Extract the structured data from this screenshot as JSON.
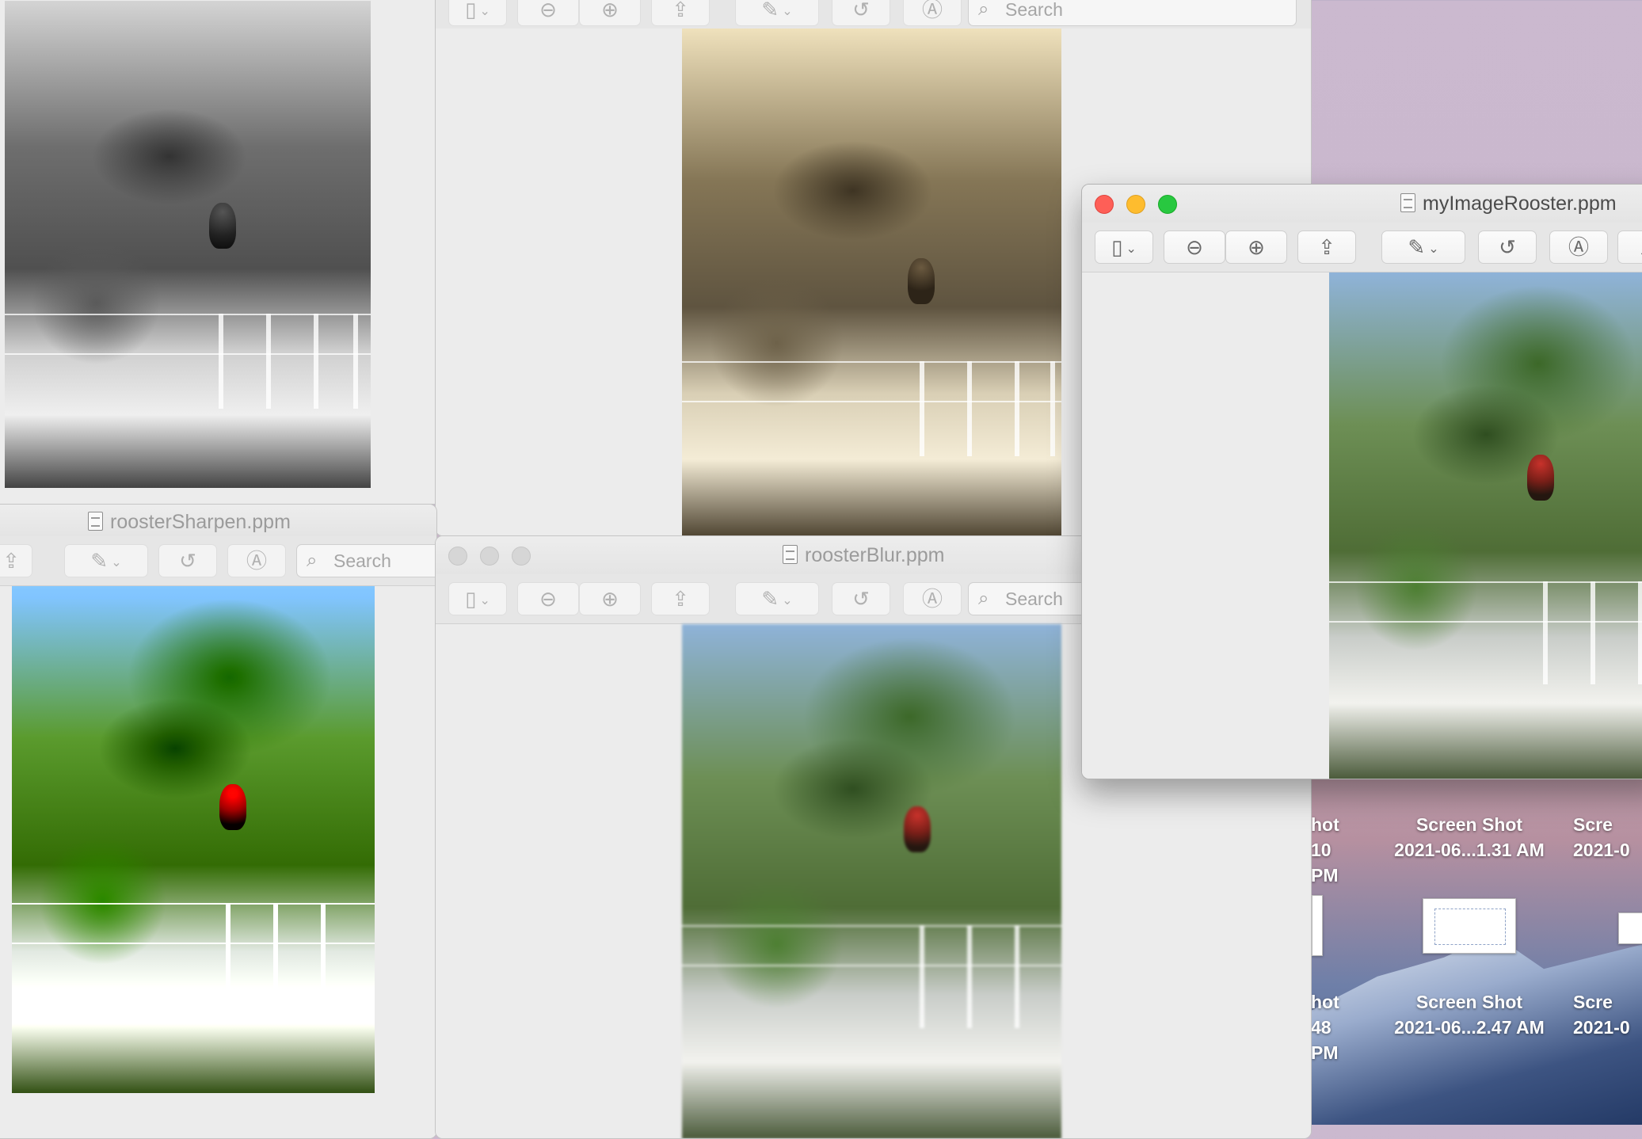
{
  "desktop": {
    "icons": [
      {
        "line1": "Screen Shot",
        "line2": "2021-06...1.31 AM"
      },
      {
        "line1": "Screen Shot",
        "line2": "2021-06...2.47 AM"
      }
    ],
    "partial_icons": [
      {
        "line1": "hot",
        "line2": "10 PM"
      },
      {
        "line1": "Scre",
        "line2": "2021-0"
      },
      {
        "line1": "hot",
        "line2": "48 PM"
      },
      {
        "line1": "Scre",
        "line2": "2021-0"
      }
    ]
  },
  "windows": {
    "gray_window": {
      "filter": "grayscale"
    },
    "sepia_window": {
      "search_placeholder": "Search",
      "filter": "sepia"
    },
    "sharpen_window": {
      "title": "roosterSharpen.ppm",
      "search_placeholder": "Search"
    },
    "blur_window": {
      "title": "roosterBlur.ppm",
      "search_placeholder": "Search"
    },
    "original_window": {
      "title": "myImageRooster.ppm"
    }
  },
  "icons": {
    "sidebar": "sidebar-icon",
    "zoom_out": "zoom-out-icon",
    "zoom_in": "zoom-in-icon",
    "share": "share-icon",
    "markup": "pen-icon",
    "rotate": "rotate-icon",
    "annotate": "markup-circle-icon",
    "search": "search-icon"
  },
  "colors": {
    "close": "#fe5f57",
    "minimize": "#febc2e",
    "zoom": "#28c840",
    "window_bg": "#ececec"
  }
}
